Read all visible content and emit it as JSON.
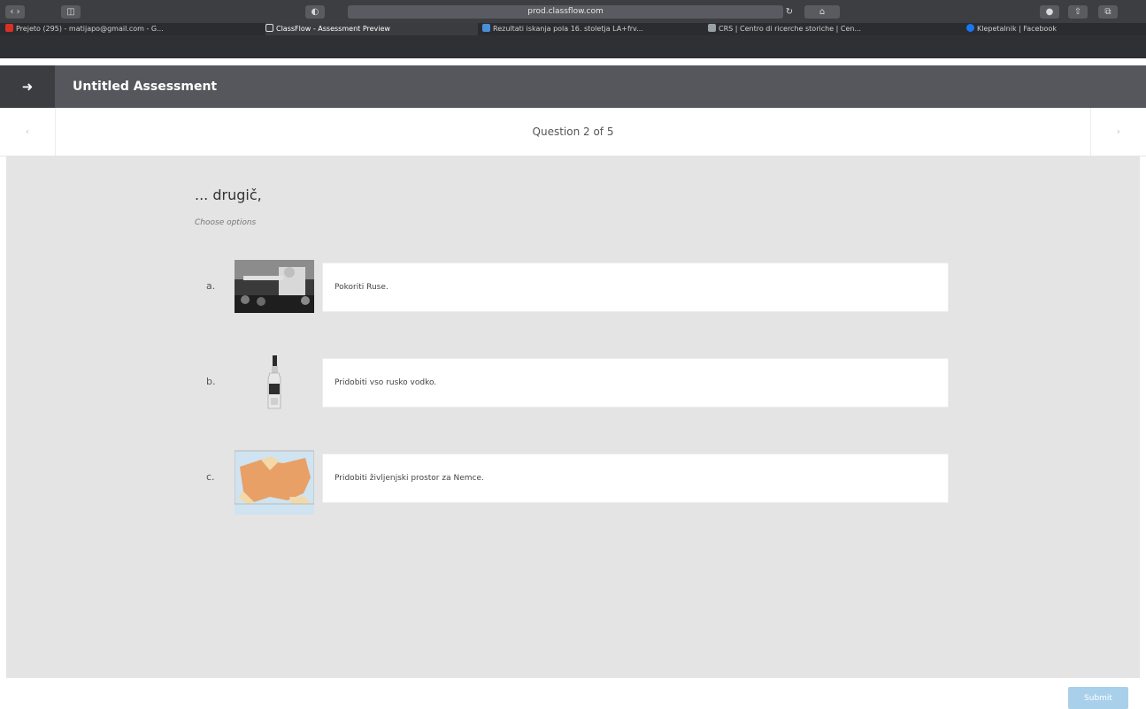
{
  "browser": {
    "url": "prod.classflow.com",
    "tabs": [
      {
        "label": "Prejeto (295) - matijapo@gmail.com - G...",
        "icon": "gmail-icon",
        "icon_color": "#d93025"
      },
      {
        "label": "ClassFlow - Assessment Preview",
        "icon": "classflow-icon",
        "icon_color": "#ffffff",
        "active": true
      },
      {
        "label": "Rezultati iskanja pola 16. stoletja LA+frv...",
        "icon": "document-icon",
        "icon_color": "#4a90d9"
      },
      {
        "label": "CRS | Centro di ricerche storiche | Cen...",
        "icon": "site-icon",
        "icon_color": "#9aa0a6"
      },
      {
        "label": "Klepetalnik | Facebook",
        "icon": "facebook-icon",
        "icon_color": "#1877f2"
      }
    ]
  },
  "app": {
    "title": "Untitled Assessment"
  },
  "nav": {
    "counter": "Question 2 of 5"
  },
  "question": {
    "title": "... drugič,",
    "instruction": "Choose options",
    "options": [
      {
        "letter": "a.",
        "text": "Pokoriti Ruse.",
        "image": "speech-photo"
      },
      {
        "letter": "b.",
        "text": "Pridobiti vso rusko vodko.",
        "image": "vodka-bottle"
      },
      {
        "letter": "c.",
        "text": "Pridobiti življenjski prostor za Nemce.",
        "image": "europe-map"
      }
    ]
  },
  "footer": {
    "submit": "Submit"
  }
}
